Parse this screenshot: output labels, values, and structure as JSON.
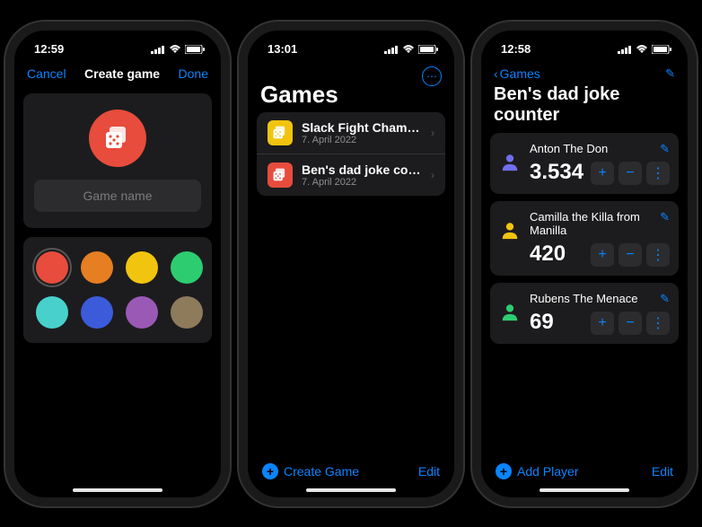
{
  "phone1": {
    "time": "12:59",
    "nav": {
      "cancel": "Cancel",
      "title": "Create game",
      "done": "Done"
    },
    "iconColor": "#e74c3c",
    "input": {
      "placeholder": "Game name",
      "value": ""
    },
    "colors": [
      {
        "hex": "#e74c3c",
        "selected": true
      },
      {
        "hex": "#e67e22",
        "selected": false
      },
      {
        "hex": "#f1c40f",
        "selected": false
      },
      {
        "hex": "#2ecc71",
        "selected": false
      },
      {
        "hex": "#48d1cc",
        "selected": false
      },
      {
        "hex": "#3b5bdb",
        "selected": false
      },
      {
        "hex": "#9b59b6",
        "selected": false
      },
      {
        "hex": "#8d7b5b",
        "selected": false
      }
    ]
  },
  "phone2": {
    "time": "13:01",
    "title": "Games",
    "games": [
      {
        "name": "Slack Fight Champi…",
        "date": "7. April 2022",
        "color": "#f1c40f"
      },
      {
        "name": "Ben's dad joke cou…",
        "date": "7. April 2022",
        "color": "#e74c3c"
      }
    ],
    "toolbar": {
      "create": "Create Game",
      "edit": "Edit"
    }
  },
  "phone3": {
    "time": "12:58",
    "back": "Games",
    "title": "Ben's dad joke counter",
    "players": [
      {
        "name": "Anton The Don",
        "score": "3.534",
        "avatarColor": "#6f6ff0"
      },
      {
        "name": "Camilla the Killa from Manilla",
        "score": "420",
        "avatarColor": "#f1c40f"
      },
      {
        "name": "Rubens The Menace",
        "score": "69",
        "avatarColor": "#2ecc71"
      }
    ],
    "toolbar": {
      "add": "Add Player",
      "edit": "Edit"
    }
  }
}
